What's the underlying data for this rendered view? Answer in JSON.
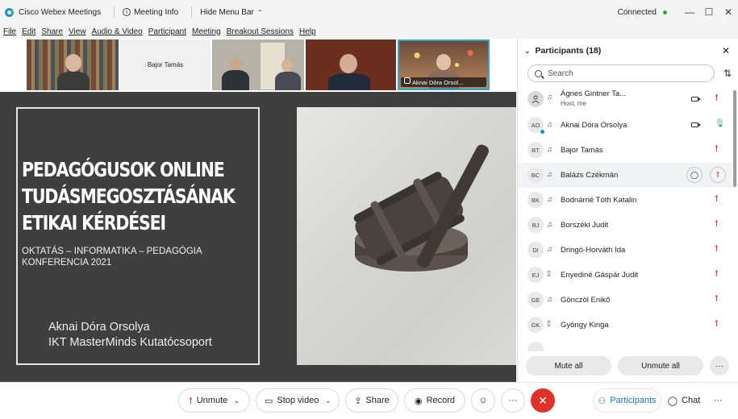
{
  "titlebar": {
    "app_name": "Cisco Webex Meetings",
    "meeting_info": "Meeting Info",
    "hide_menu_bar": "Hide Menu Bar",
    "status": "Connected",
    "status_color": "#2fa44f",
    "minimize": "—",
    "maximize": "☐",
    "close": "✕"
  },
  "menu": {
    "items": [
      "File",
      "Edit",
      "Share",
      "View",
      "Audio & Video",
      "Participant",
      "Meeting",
      "Breakout Sessions",
      "Help"
    ]
  },
  "thumbnails": {
    "bajor_label": "Bajor Tamás",
    "active_label": "Aknai Dóra Orsol..."
  },
  "slide": {
    "title_line1": "PEDAGÓGUSOK ONLINE",
    "title_line2": "TUDÁSMEGOSZTÁSÁNAK",
    "title_line3": "ETIKAI KÉRDÉSEI",
    "subtitle_line1": "OKTATÁS – INFORMATIKA – PEDAGÓGIA",
    "subtitle_line2": "KONFERENCIA 2021",
    "author_line1": "Aknai Dóra Orsolya",
    "author_line2": "IKT MasterMinds Kutatócsoport"
  },
  "panel": {
    "title": "Participants (18)",
    "search_placeholder": "Search",
    "participants": [
      {
        "initials": "",
        "name": "Ágnes Gintner Ta...",
        "role": "Host, me",
        "audio": "headset",
        "video": true,
        "mic": "muted"
      },
      {
        "initials": "AO",
        "name": "Aknai Dóra Orsolya",
        "role": "",
        "audio": "headset",
        "video": true,
        "mic": "on"
      },
      {
        "initials": "BT",
        "name": "Bajor Tamás",
        "role": "",
        "audio": "headset",
        "video": false,
        "mic": "muted"
      },
      {
        "initials": "BC",
        "name": "Balázs Czékmán",
        "role": "",
        "audio": "headset",
        "video": false,
        "mic": "muted"
      },
      {
        "initials": "BK",
        "name": "Bodnárné Tóth Katalin",
        "role": "",
        "audio": "headset",
        "video": false,
        "mic": "muted"
      },
      {
        "initials": "BJ",
        "name": "Borszéki Judit",
        "role": "",
        "audio": "headset",
        "video": false,
        "mic": "muted"
      },
      {
        "initials": "DI",
        "name": "Dringó-Horváth Ida",
        "role": "",
        "audio": "headset",
        "video": false,
        "mic": "muted"
      },
      {
        "initials": "EJ",
        "name": "Enyediné Gáspár Judit",
        "role": "",
        "audio": "phone",
        "video": false,
        "mic": "muted"
      },
      {
        "initials": "GE",
        "name": "Gönczöl Enikő",
        "role": "",
        "audio": "headset",
        "video": false,
        "mic": "muted"
      },
      {
        "initials": "GK",
        "name": "Gyöngy Kinga",
        "role": "",
        "audio": "phone",
        "video": false,
        "mic": "muted"
      }
    ],
    "mute_all": "Mute all",
    "unmute_all": "Unmute all",
    "more": "···"
  },
  "controls": {
    "unmute": "Unmute",
    "stop_video": "Stop video",
    "share": "Share",
    "record": "Record",
    "emoji": "☺",
    "more": "···",
    "end": "✕",
    "participants": "Participants",
    "chat": "Chat",
    "more_right": "···",
    "end_color": "#e0312b",
    "accent_color": "#1a73c8"
  }
}
